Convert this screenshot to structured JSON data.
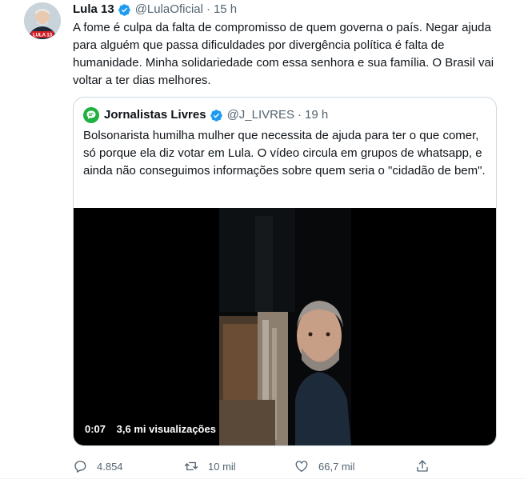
{
  "tweet": {
    "author_name": "Lula 13",
    "handle": "@LulaOficial",
    "separator": "·",
    "time": "15 h",
    "text": "A fome é culpa da falta de compromisso de quem governa o país. Negar ajuda para alguém que passa dificuldades por divergência política é falta de humanidade. Minha solidariedade com essa senhora e sua família. O Brasil vai voltar a ter dias melhores.",
    "avatar_badge": "LULA 13",
    "verified_icon": "verified-badge-icon"
  },
  "quote": {
    "author_name": "Jornalistas Livres",
    "handle": "@J_LIVRES",
    "separator": "·",
    "time": "19 h",
    "text": "Bolsonarista humilha mulher que necessita de ajuda para ter o que comer, só porque ela diz votar em Lula. O vídeo circula em grupos de whatsapp, e ainda não conseguimos informações sobre quem seria o \"cidadão de bem\".",
    "video": {
      "elapsed": "0:07",
      "views": "3,6 mi visualizações"
    }
  },
  "actions": {
    "replies": "4.854",
    "retweets": "10 mil",
    "likes": "66,7 mil"
  },
  "colors": {
    "verified": "#1d9bf0",
    "muted": "#536471",
    "text": "#0f1419",
    "border": "#cfd9de",
    "quote_avatar": "#1fb141"
  }
}
